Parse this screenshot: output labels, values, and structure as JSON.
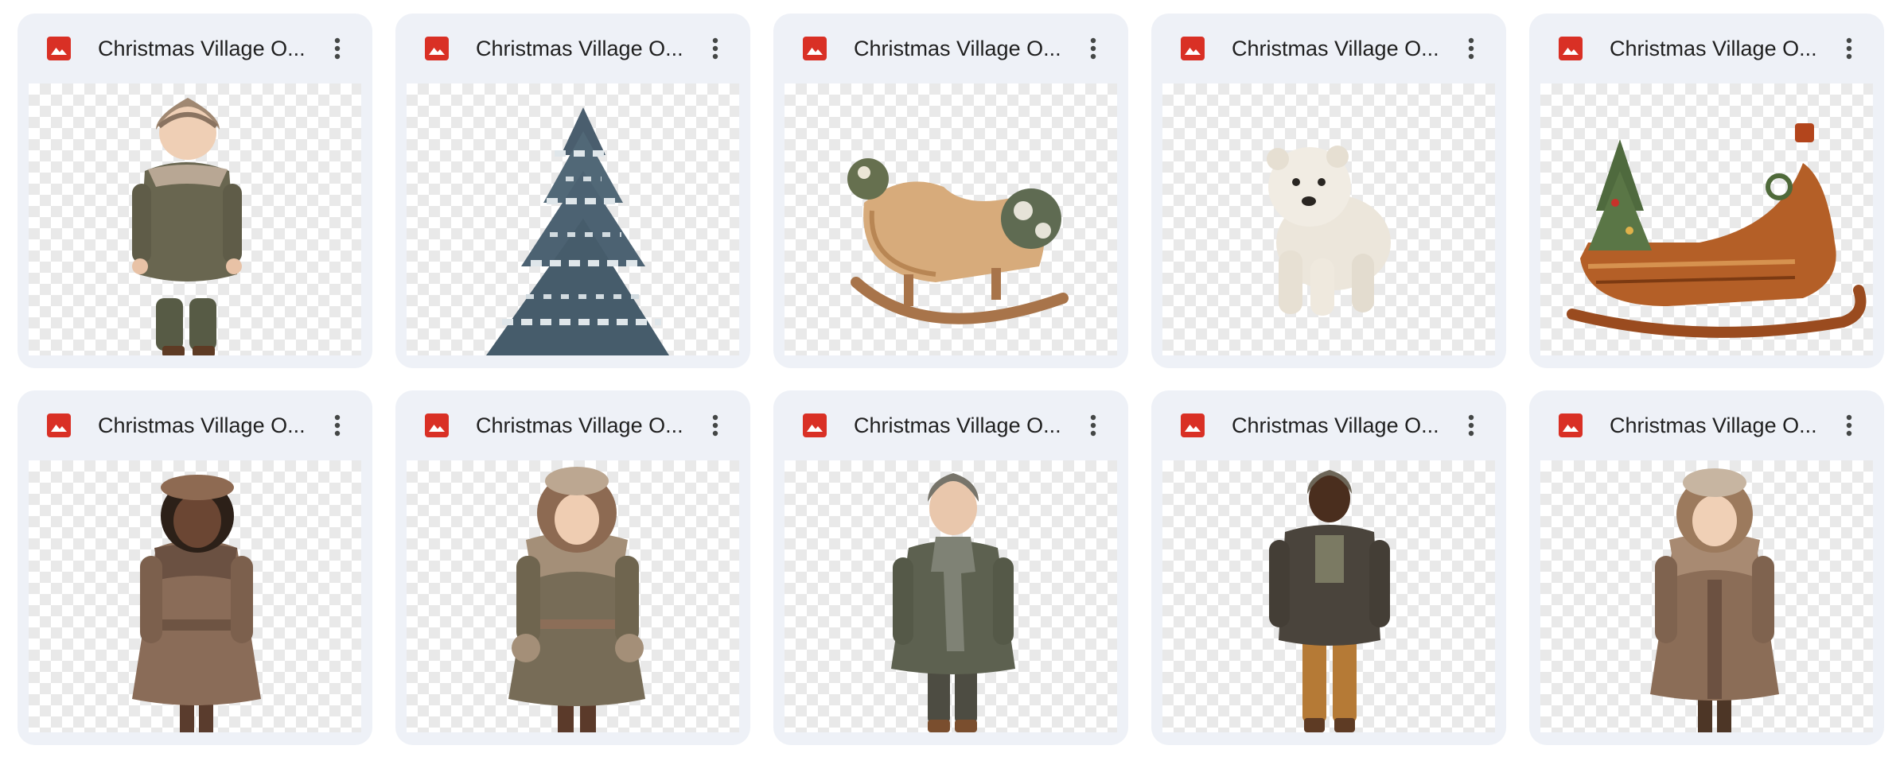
{
  "colors": {
    "card_bg": "#eef1f7",
    "image_icon_red": "#d93025",
    "title_text": "#1f1f1f",
    "more_icon": "#444746"
  },
  "files": [
    {
      "title": "Christmas Village O...",
      "icon": "image-file-icon",
      "subject": "child-in-knit-hat-and-green-coat"
    },
    {
      "title": "Christmas Village O...",
      "icon": "image-file-icon",
      "subject": "snowy-christmas-tree"
    },
    {
      "title": "Christmas Village O...",
      "icon": "image-file-icon",
      "subject": "wooden-sleigh-with-greenery"
    },
    {
      "title": "Christmas Village O...",
      "icon": "image-file-icon",
      "subject": "polar-bear-cub"
    },
    {
      "title": "Christmas Village O...",
      "icon": "image-file-icon",
      "subject": "ornate-sleigh-with-tree"
    },
    {
      "title": "Christmas Village O...",
      "icon": "image-file-icon",
      "subject": "girl-in-beret-and-fur-coat"
    },
    {
      "title": "Christmas Village O...",
      "icon": "image-file-icon",
      "subject": "girl-in-olive-fur-coat"
    },
    {
      "title": "Christmas Village O...",
      "icon": "image-file-icon",
      "subject": "boy-in-scarf-and-green-coat"
    },
    {
      "title": "Christmas Village O...",
      "icon": "image-file-icon",
      "subject": "boy-in-beanie-and-brown-jacket"
    },
    {
      "title": "Christmas Village O...",
      "icon": "image-file-icon",
      "subject": "girl-in-tan-fur-coat"
    }
  ]
}
